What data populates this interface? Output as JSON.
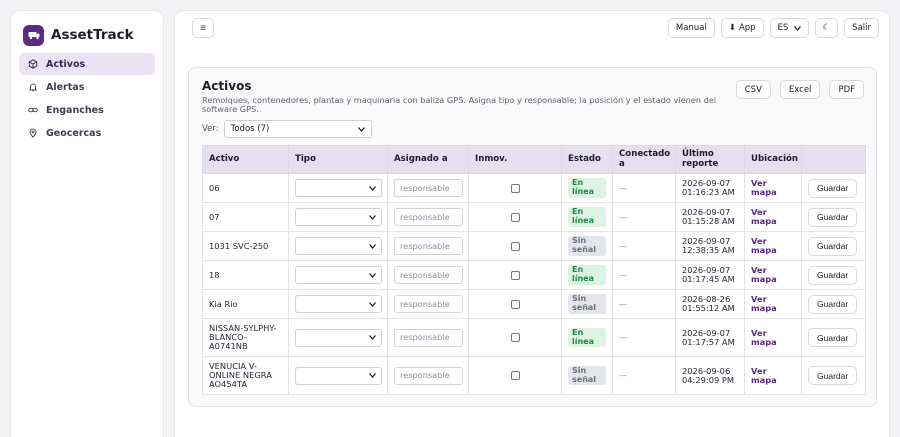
{
  "app": {
    "name": "AssetTrack"
  },
  "sidebar": {
    "items": [
      {
        "label": "Activos",
        "icon": "box-icon",
        "active": true
      },
      {
        "label": "Alertas",
        "icon": "bell-icon",
        "active": false
      },
      {
        "label": "Enganches",
        "icon": "link-icon",
        "active": false
      },
      {
        "label": "Geocercas",
        "icon": "map-pin-icon",
        "active": false
      }
    ]
  },
  "topbar": {
    "menu_glyph": "≡",
    "manual": "Manual",
    "app_label": "App",
    "app_glyph": "⬇",
    "lang": "ES",
    "theme_glyph": "☾",
    "logout": "Salir"
  },
  "card": {
    "title": "Activos",
    "subtitle": "Remolques, contenedores, plantas y maquinaria con baliza GPS. Asigna tipo y responsable; la posición y el estado vienen del software GPS.",
    "export": {
      "csv": "CSV",
      "excel": "Excel",
      "pdf": "PDF"
    },
    "filter_label": "Ver:",
    "filter_value": "Todos (7)"
  },
  "table": {
    "headers": {
      "asset": "Activo",
      "type": "Tipo",
      "assigned": "Asignado a",
      "immob": "Inmov.",
      "state": "Estado",
      "connected": "Conectado a",
      "last_report": "Último reporte",
      "location": "Ubicación"
    },
    "placeholder": "responsable",
    "map_label": "Ver mapa",
    "save_label": "Guardar",
    "dash": "—",
    "rows": [
      {
        "asset": "06",
        "state": "En línea",
        "last_date": "2026-09-07",
        "last_time": "01:16:23 AM"
      },
      {
        "asset": "07",
        "state": "En línea",
        "last_date": "2026-09-07",
        "last_time": "01:15:28 AM"
      },
      {
        "asset": "1031 SVC-250",
        "state": "Sin señal",
        "last_date": "2026-09-07",
        "last_time": "12:38:35 AM"
      },
      {
        "asset": "18",
        "state": "En línea",
        "last_date": "2026-09-07",
        "last_time": "01:17:45 AM"
      },
      {
        "asset": "Kia Rio",
        "state": "Sin señal",
        "last_date": "2026-08-26",
        "last_time": "01:55:12 AM"
      },
      {
        "asset": "NISSAN-SYLPHY-BLANCO-A0741NB",
        "state": "En línea",
        "last_date": "2026-09-07",
        "last_time": "01:17:57 AM"
      },
      {
        "asset": "VENUCIA V-ONLINE NEGRA AO454TA",
        "state": "Sin señal",
        "last_date": "2026-09-06",
        "last_time": "04:29:09 PM"
      }
    ]
  },
  "colors": {
    "accent": "#5b2a86",
    "online": "#1e8a46",
    "offline": "#6a6f7c",
    "header": "#e6dff0"
  }
}
